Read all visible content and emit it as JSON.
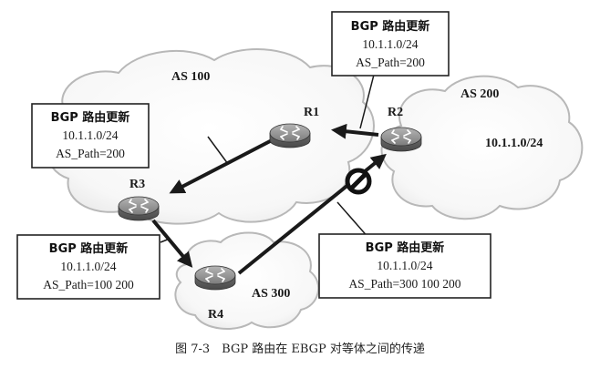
{
  "clouds": {
    "as100": "AS 100",
    "as200": "AS 200",
    "as300": "AS 300"
  },
  "routers": {
    "r1": "R1",
    "r2": "R2",
    "r3": "R3",
    "r4": "R4"
  },
  "as200_prefix": "10.1.1.0/24",
  "updates": {
    "r2_to_r1": {
      "title": "BGP 路由更新",
      "prefix": "10.1.1.0/24",
      "as_path": "AS_Path=200"
    },
    "r1_to_r3": {
      "title": "BGP 路由更新",
      "prefix": "10.1.1.0/24",
      "as_path": "AS_Path=200"
    },
    "r3_to_r4": {
      "title": "BGP 路由更新",
      "prefix": "10.1.1.0/24",
      "as_path": "AS_Path=100 200"
    },
    "r4_to_r2": {
      "title": "BGP 路由更新",
      "prefix": "10.1.1.0/24",
      "as_path": "AS_Path=300 100 200"
    }
  },
  "caption": "图 7-3　BGP 路由在 EBGP 对等体之间的传递",
  "colors": {
    "arrow": "#1a1a1a",
    "router_body": "#8a8a8a",
    "cloud_fill": "#f4f4f4",
    "box_border": "#222222"
  }
}
